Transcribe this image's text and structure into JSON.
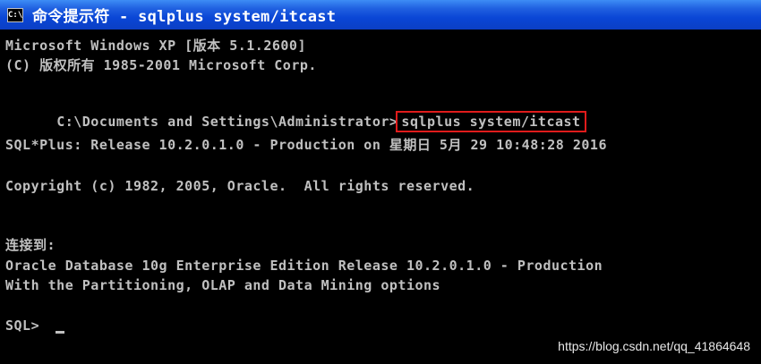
{
  "window": {
    "icon_text": "C:\\",
    "title": "命令提示符 - sqlplus system/itcast"
  },
  "console": {
    "lines": [
      "Microsoft Windows XP [版本 5.1.2600]",
      "(C) 版权所有 1985-2001 Microsoft Corp.",
      "",
      "C:\\Documents and Settings\\Administrator>",
      "",
      "SQL*Plus: Release 10.2.0.1.0 - Production on 星期日 5月 29 10:48:28 2016",
      "",
      "Copyright (c) 1982, 2005, Oracle.  All rights reserved.",
      "",
      "",
      "连接到:",
      "Oracle Database 10g Enterprise Edition Release 10.2.0.1.0 - Production",
      "With the Partitioning, OLAP and Data Mining options",
      "",
      "SQL> "
    ],
    "command": "sqlplus system/itcast"
  },
  "watermark": "https://blog.csdn.net/qq_41864648"
}
